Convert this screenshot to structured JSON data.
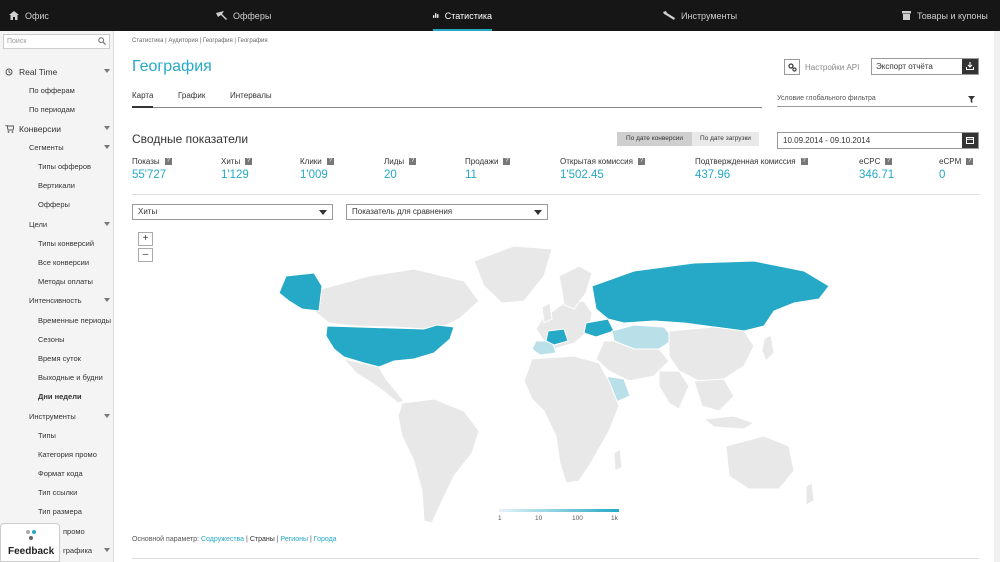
{
  "nav": {
    "office": "Офис",
    "offers": "Офферы",
    "stats": "Статистика",
    "tools": "Инструменты",
    "goods": "Товары и купоны"
  },
  "sidebar": {
    "search_placeholder": "Поиск",
    "items": [
      {
        "label": "Real Time"
      },
      {
        "label": "По офферам"
      },
      {
        "label": "По периодам"
      },
      {
        "label": "Конверсии"
      },
      {
        "label": "Сегменты"
      },
      {
        "label": "Типы офферов"
      },
      {
        "label": "Вертикали"
      },
      {
        "label": "Офферы"
      },
      {
        "label": "Цели"
      },
      {
        "label": "Типы конверсий"
      },
      {
        "label": "Все конверсии"
      },
      {
        "label": "Методы оплаты"
      },
      {
        "label": "Интенсивность"
      },
      {
        "label": "Временные периоды"
      },
      {
        "label": "Сезоны"
      },
      {
        "label": "Время суток"
      },
      {
        "label": "Выходные и будни"
      },
      {
        "label": "Дни недели"
      },
      {
        "label": "Инструменты"
      },
      {
        "label": "Типы"
      },
      {
        "label": "Категория промо"
      },
      {
        "label": "Формат кода"
      },
      {
        "label": "Тип ссылки"
      },
      {
        "label": "Тип размера"
      },
      {
        "label": "промо"
      },
      {
        "label": "графика"
      }
    ],
    "feedback": "Feedback"
  },
  "page": {
    "breadcrumb": "Статистика | Аудитория | География | География",
    "title": "География",
    "tabs": [
      "Карта",
      "График",
      "Интервалы"
    ],
    "api_label": "Настройки API",
    "export_label": "Экспорт отчёта",
    "filter_label": "Условие глобального фильтра",
    "summary_title": "Сводные показатели",
    "seg_conv": "По дате конверсии",
    "seg_load": "По дате загрузки",
    "date_range": "10.09.2014 - 09.10.2014"
  },
  "stats": [
    {
      "label": "Показы",
      "value": "55'727"
    },
    {
      "label": "Хиты",
      "value": "1'129"
    },
    {
      "label": "Клики",
      "value": "1'009"
    },
    {
      "label": "Лиды",
      "value": "20"
    },
    {
      "label": "Продажи",
      "value": "11"
    },
    {
      "label": "Открытая комиссия",
      "value": "1'502.45"
    },
    {
      "label": "Подтвержденная комиссия",
      "value": "437.96"
    },
    {
      "label": "eCPC",
      "value": "346.71"
    },
    {
      "label": "eCPM",
      "value": "0"
    }
  ],
  "controls": {
    "metric_select": "Хиты",
    "compare_select": "Показатель для сравнения",
    "zoom_in": "+",
    "zoom_out": "–"
  },
  "legend": {
    "ticks": [
      "1",
      "10",
      "100",
      "1k"
    ]
  },
  "param": {
    "label": "Основной параметр:",
    "options": [
      "Содружества",
      "Страны",
      "Регионы",
      "Города"
    ],
    "sep": "|"
  },
  "colors": {
    "accent": "#25a9c7",
    "topbar": "#161616",
    "map_land": "#e8e8e8",
    "map_light": "#b9dfe9"
  }
}
